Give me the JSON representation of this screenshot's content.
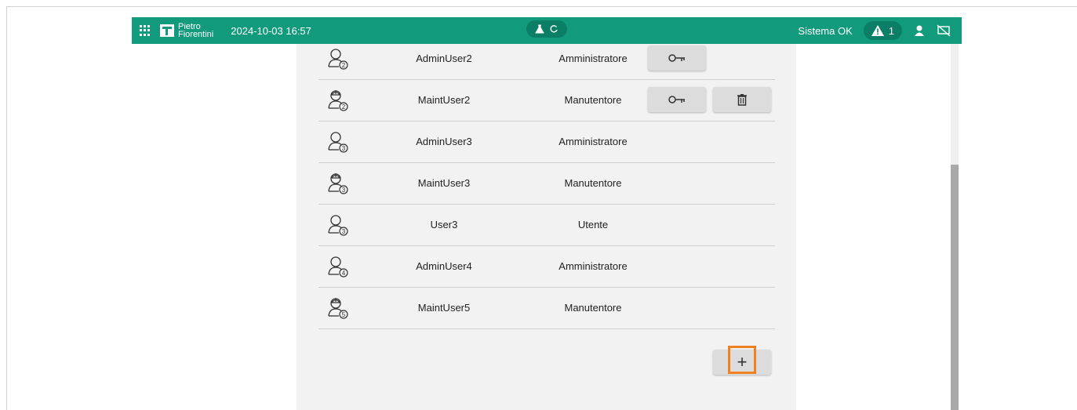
{
  "topbar": {
    "brand_line1": "Pietro",
    "brand_line2": "Fiorentini",
    "datetime": "2024-10-03 16:57",
    "status": "Sistema OK",
    "alarm_count": "1"
  },
  "users": [
    {
      "name": "AdminUser2",
      "role": "Amministratore",
      "level": "2",
      "icon": "admin-user-icon",
      "has_key": true,
      "has_delete": false
    },
    {
      "name": "MaintUser2",
      "role": "Manutentore",
      "level": "2",
      "icon": "maintenance-user-icon",
      "has_key": true,
      "has_delete": true
    },
    {
      "name": "AdminUser3",
      "role": "Amministratore",
      "level": "3",
      "icon": "admin-user-icon",
      "has_key": false,
      "has_delete": false
    },
    {
      "name": "MaintUser3",
      "role": "Manutentore",
      "level": "3",
      "icon": "maintenance-user-icon",
      "has_key": false,
      "has_delete": false
    },
    {
      "name": "User3",
      "role": "Utente",
      "level": "3",
      "icon": "user-icon",
      "has_key": false,
      "has_delete": false
    },
    {
      "name": "AdminUser4",
      "role": "Amministratore",
      "level": "4",
      "icon": "admin-user-icon",
      "has_key": false,
      "has_delete": false
    },
    {
      "name": "MaintUser5",
      "role": "Manutentore",
      "level": "5",
      "icon": "maintenance-user-icon",
      "has_key": false,
      "has_delete": false
    }
  ],
  "add_button": {
    "label": "+"
  },
  "colors": {
    "topbar": "#119b7c",
    "highlight": "#f08020",
    "panel": "#f2f2f2"
  }
}
